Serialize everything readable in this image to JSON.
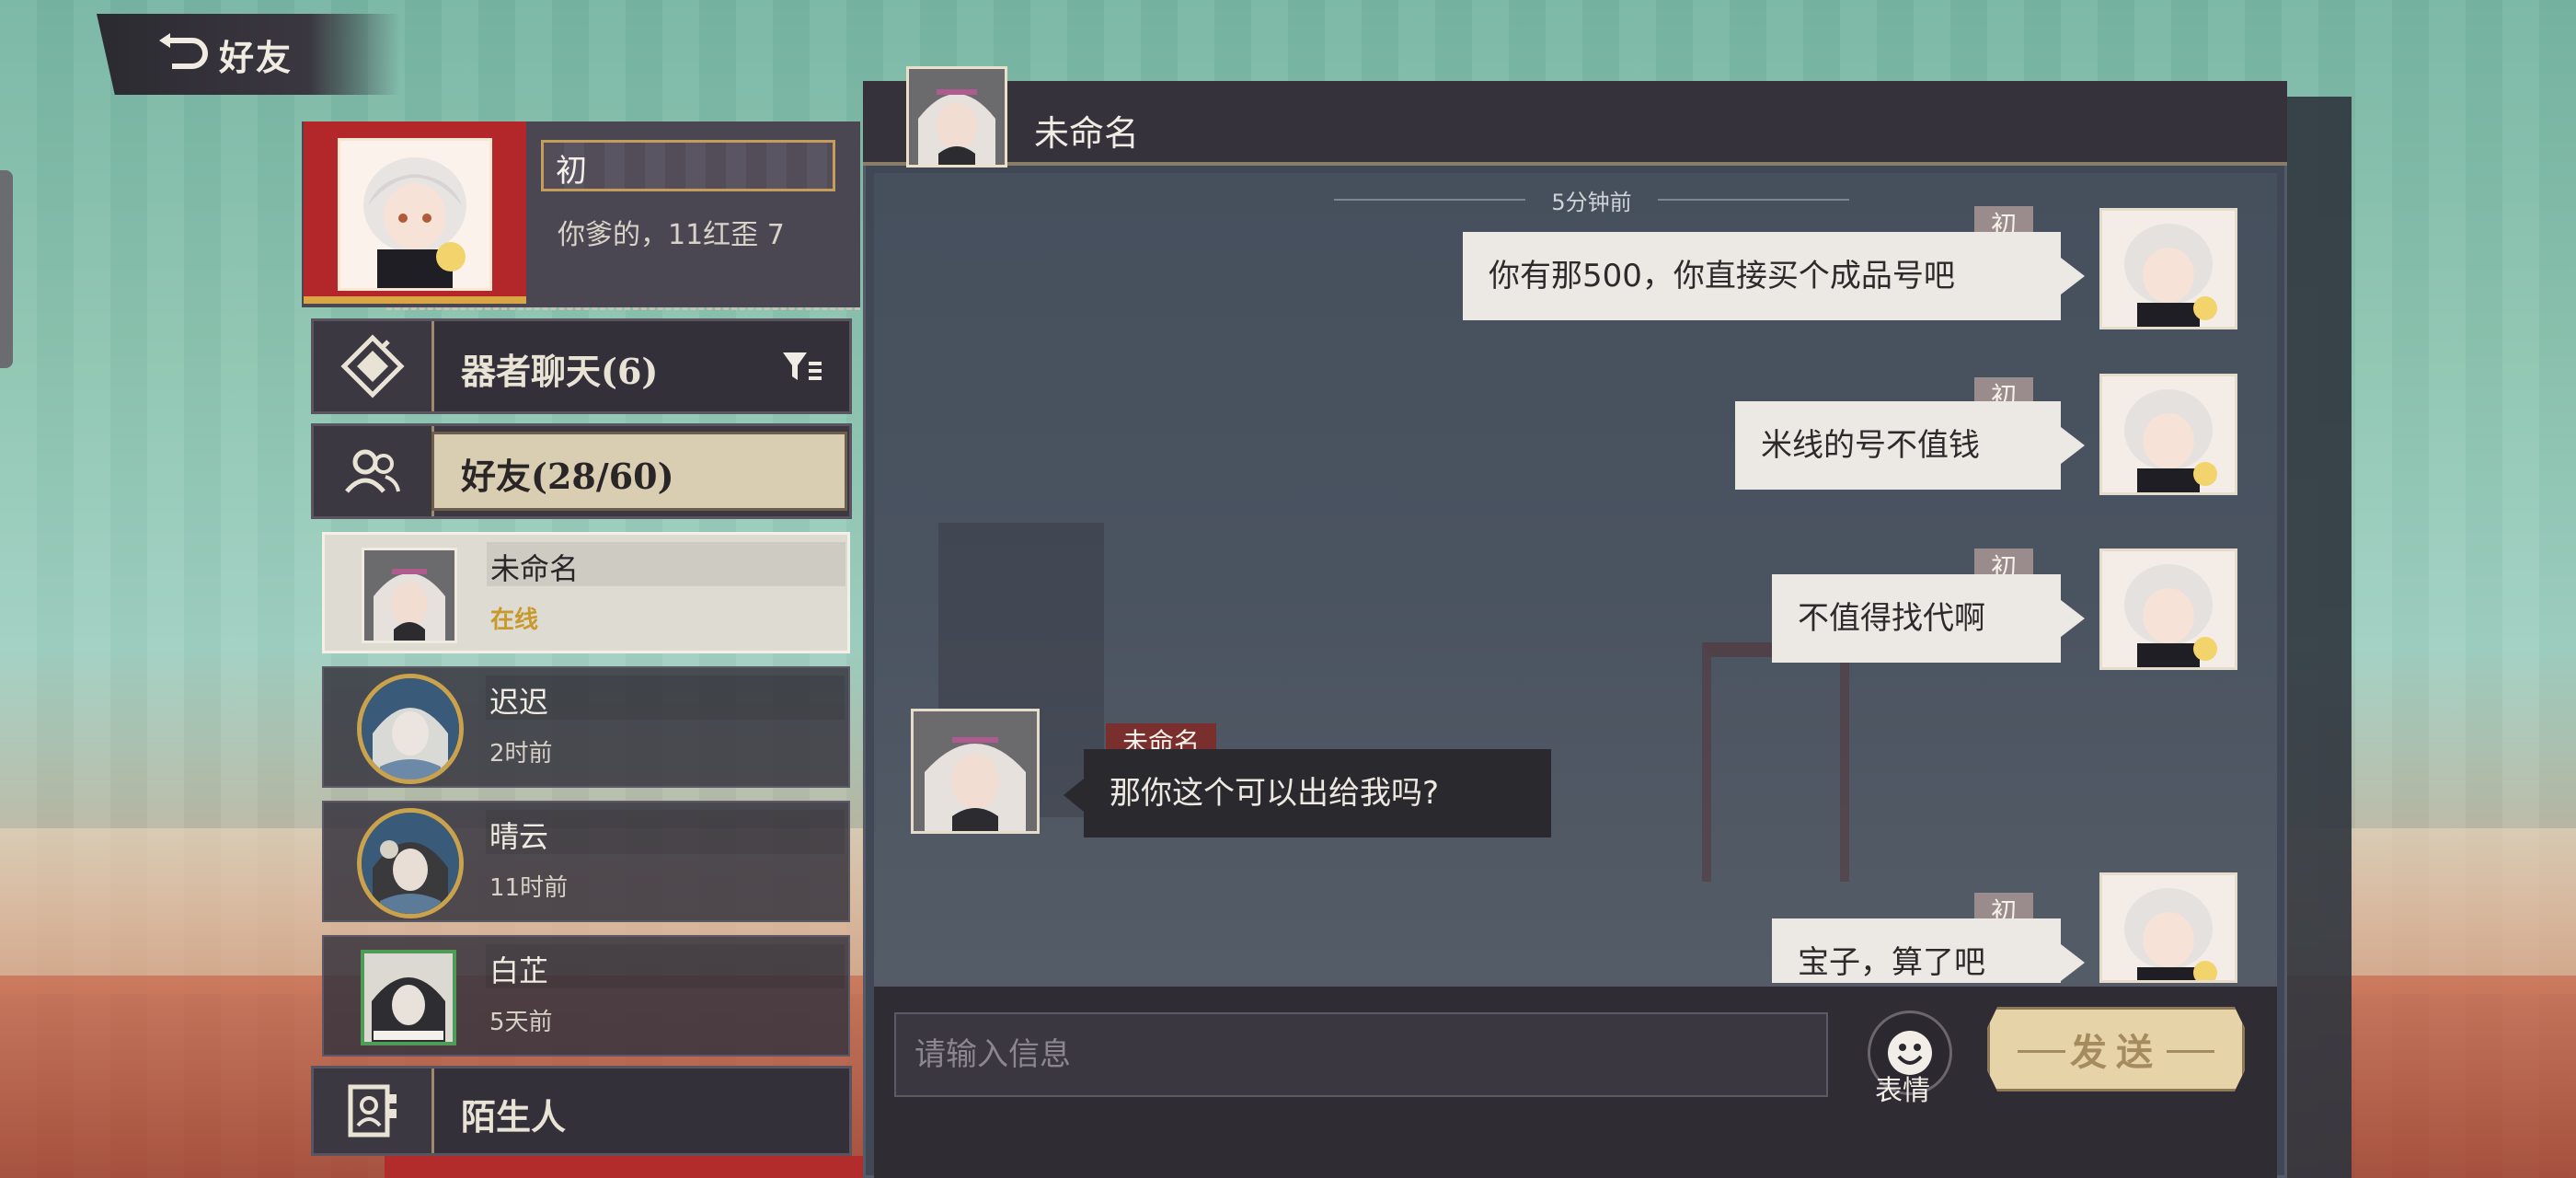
{
  "header": {
    "back_title": "好友",
    "back_icon": "return-arrow-icon"
  },
  "profile": {
    "name": "初",
    "signature": "你爹的，11红歪 7"
  },
  "categories": [
    {
      "label": "器者聊天(6)",
      "icon": "diamond-chat-icon",
      "filter_icon": "filter-icon"
    },
    {
      "label": "好友(28/60)",
      "icon": "friends-icon"
    },
    {
      "label": "陌生人",
      "icon": "stranger-icon"
    }
  ],
  "friends": [
    {
      "name": "未命名",
      "status": "在线"
    },
    {
      "name": "迟迟",
      "status": "2时前"
    },
    {
      "name": "晴云",
      "status": "11时前"
    },
    {
      "name": "白芷",
      "status": "5天前"
    }
  ],
  "chat": {
    "title": "未命名",
    "time_separator": "5分钟前",
    "messages": [
      {
        "sender": "初",
        "text": "你有那500，你直接买个成品号吧",
        "mine": true
      },
      {
        "sender": "初",
        "text": "米线的号不值钱",
        "mine": true
      },
      {
        "sender": "初",
        "text": "不值得找代啊",
        "mine": true
      },
      {
        "sender": "未命名",
        "text": "那你这个可以出给我吗?",
        "mine": false
      },
      {
        "sender": "初",
        "text": "宝子，算了吧",
        "mine": true
      }
    ],
    "input_placeholder": "请输入信息",
    "emoji_label": "表情",
    "send_label": "发送"
  },
  "colors": {
    "accent_gold": "#c69c5a",
    "online": "#c89a2e",
    "red_frame": "#b3272a"
  }
}
